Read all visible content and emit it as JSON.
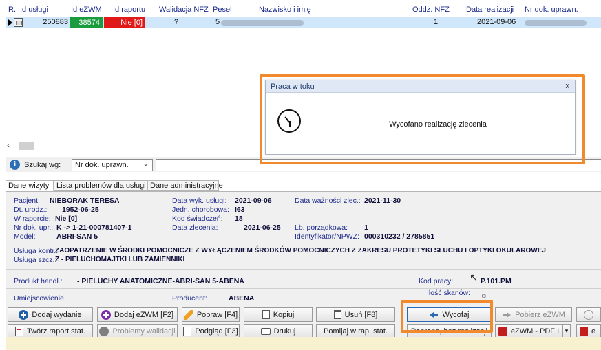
{
  "grid": {
    "columns": [
      "R.",
      "Id usługi",
      "Id eZWM",
      "Id raportu",
      "Walidacja NFZ",
      "Pesel",
      "Nazwisko i imię",
      "Oddz. NFZ",
      "Data realizacji",
      "Nr dok. uprawn."
    ],
    "row": {
      "id_uslugi": "250883",
      "id_ezwm": "38574",
      "id_raportu": "Nie [0]",
      "walidacja": "?",
      "pesel": "5",
      "nazwisko": "NIEBORAK TERESA",
      "oddz": "1",
      "data_realizacji": "2021-09-06"
    }
  },
  "search": {
    "label_underline": "S",
    "label_rest": "zukaj wg:",
    "selected": "Nr dok. uprawn.",
    "query": ""
  },
  "tabs": [
    "Dane wizyty",
    "Lista problemów dla usługi",
    "Dane administracyjne"
  ],
  "details": {
    "pacjent_label": "Pacjent:",
    "pacjent": "NIEBORAK TERESA",
    "dt_urodz_label": "Dt. urodz.:",
    "dt_urodz": "1952-06-25",
    "w_raporcie_label": "W raporcie:",
    "w_raporcie": "Nie [0]",
    "nr_dok_label": "Nr dok. upr.:",
    "nr_dok": "K -> 1-21-000781407-1",
    "model_label": "Model:",
    "model": "ABRI-SAN 5",
    "data_wyk_label": "Data wyk. usługi:",
    "data_wyk": "2021-09-06",
    "jedn_label": "Jedn. chorobowa:",
    "jedn": "I63",
    "kod_sw_label": "Kod świadczeń:",
    "kod_sw": "18",
    "data_zlec_label": "Data zlecenia:",
    "data_zlec": "2021-06-25",
    "data_waz_label": "Data ważności zlec.:",
    "data_waz": "2021-11-30",
    "lb_porz_label": "Lb. porządkowa:",
    "lb_porz": "1",
    "ident_label": "Identyfikator/NPWZ:",
    "ident": "000310232 / 2785851",
    "usluga_kontr_label": "Usługa kontr.:",
    "usluga_kontr": "ZAOPATRZENIE W ŚRODKI POMOCNICZE Z WYŁĄCZENIEM ŚRODKÓW POMOCNICZYCH Z ZAKRESU PROTETYKI SŁUCHU I OPTYKI OKULAROWEJ",
    "usluga_szcz_label": "Usługa szcz.:",
    "usluga_szcz": "Z - PIELUCHOMAJTKI LUB ZAMIENNIKI",
    "produkt_label": "Produkt handl.:",
    "produkt": "- PIELUCHY ANATOMICZNE-ABRI-SAN 5-ABENA",
    "kod_pracy_label": "Kod pracy:",
    "kod_pracy": "P.101.PM",
    "umiejsc_label": "Umiejscowienie:",
    "producent_label": "Producent:",
    "producent": "ABENA",
    "ilosc_label": "Ilość skanów:",
    "ilosc": "0"
  },
  "buttons": {
    "dodaj_wydanie": "Dodaj wydanie",
    "dodaj_ezwm": "Dodaj eZWM [F2]",
    "popraw": "Popraw [F4]",
    "kopiuj": "Kopiuj",
    "usun": "Usuń [F8]",
    "wycofaj": "Wycofaj",
    "pobierz_ezwm": "Pobierz eZWM",
    "tworz_raport": "Twórz raport stat.",
    "problemy": "Problemy walidacji",
    "podglad": "Podgląd [F3]",
    "drukuj": "Drukuj",
    "pomijaj": "Pomijaj w rap. stat.",
    "pobrane": "Pobrane, bez realizacji",
    "ezwm_pdf": "eZWM - PDF I",
    "e_partial": "e"
  },
  "dialog": {
    "title": "Praca w toku",
    "close": "x",
    "message": "Wycofano realizację zlecenia"
  },
  "colors": {
    "highlight": "#f08a2c",
    "selected_row": "#cfe6fb",
    "green_cell": "#1a9c3e",
    "red_cell": "#e01818"
  }
}
